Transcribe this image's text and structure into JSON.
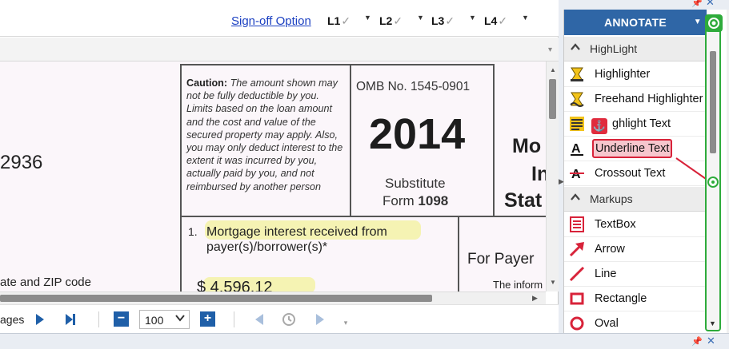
{
  "toolbar": {
    "signoff_label": "Sign-off Option",
    "levels": [
      {
        "label": "L1",
        "check": "✓"
      },
      {
        "label": "L2",
        "check": "✓"
      },
      {
        "label": "L3",
        "check": "✓"
      },
      {
        "label": "L4",
        "check": "✓"
      }
    ]
  },
  "document": {
    "left_number": "2936",
    "left_bottom_text": "ate and ZIP code",
    "caution_bold": "Caution:",
    "caution_text": " The amount shown may not be fully deductible by you. Limits based on the loan amount and the cost and value of the secured property may apply. Also, you may only deduct interest to the extent it was incurred by you, actually paid by you, and not reimbursed by another person",
    "omb": "OMB No. 1545-0901",
    "year": "2014",
    "substitute": "Substitute",
    "form_prefix": "Form",
    "form_number": "1098",
    "right_title_1": "Mo",
    "right_title_2": "In",
    "right_title_3": "Stat",
    "box1_number": "1.",
    "box1_line1": "Mortgage interest received from",
    "box1_line2": "payer(s)/borrower(s)*",
    "amount": "$  4,596.12",
    "for_payer": "For Payer",
    "info_text": "The inform"
  },
  "bottom_bar": {
    "pages_label": "ages",
    "zoom_value": "100",
    "minus": "−",
    "plus": "+"
  },
  "annotate": {
    "title": "ANNOTATE",
    "sections": [
      {
        "label": "HighLight",
        "items": [
          {
            "label": "Highlighter",
            "icon": "highlighter-icon"
          },
          {
            "label": "Freehand Highlighter",
            "icon": "freehand-highlighter-icon"
          },
          {
            "label": "Highlight Text",
            "icon": "highlight-text-icon"
          },
          {
            "label": "Underline Text",
            "icon": "underline-text-icon"
          },
          {
            "label": "Crossout Text",
            "icon": "crossout-text-icon"
          }
        ]
      },
      {
        "label": "Markups",
        "items": [
          {
            "label": "TextBox",
            "icon": "textbox-icon"
          },
          {
            "label": "Arrow",
            "icon": "arrow-icon"
          },
          {
            "label": "Line",
            "icon": "line-icon"
          },
          {
            "label": "Rectangle",
            "icon": "rectangle-icon"
          },
          {
            "label": "Oval",
            "icon": "oval-icon"
          }
        ]
      }
    ],
    "highlight_text_visible": "ghlight Text"
  },
  "colors": {
    "accent_blue": "#2f66a6",
    "link_blue": "#1a3fc1",
    "callout_red": "#d8233a",
    "callout_fill": "#f6c6cd",
    "green_handle": "#2eab3b",
    "doc_background": "#fbf6fa"
  }
}
